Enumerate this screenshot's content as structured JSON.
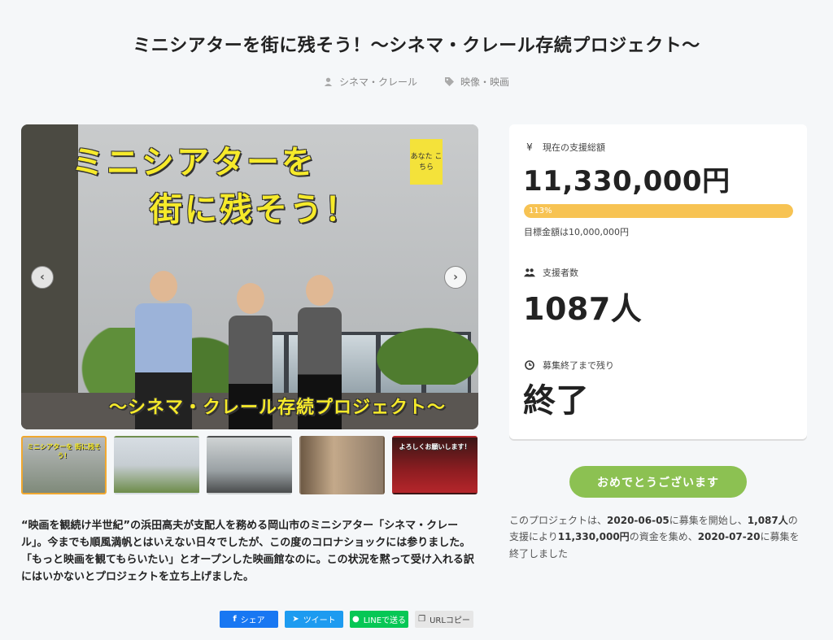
{
  "project": {
    "title": "ミニシアターを街に残そう！〜シネマ・クレール存続プロジェクト〜",
    "author": "シネマ・クレール",
    "category": "映像・映画"
  },
  "hero": {
    "text_line1": "ミニシアターを",
    "text_line2": "街に残そう！",
    "text_line3": "〜シネマ・クレール存続プロジェクト〜",
    "sticker": "あなた こちら"
  },
  "carousel": {
    "prev_icon": "chevron-left-icon",
    "next_icon": "chevron-right-icon",
    "thumbnails": [
      {
        "label": "ミニシアターを 街に残そう！",
        "active": true
      },
      {
        "label": "",
        "active": false
      },
      {
        "label": "",
        "active": false
      },
      {
        "label": "",
        "active": false
      },
      {
        "label": "よろしくお願いします！",
        "active": false
      }
    ]
  },
  "description": "“映画を観続け半世紀”の浜田高夫が支配人を務める岡山市のミニシアター「シネマ・クレール」。今までも順風満帆とはいえない日々でしたが、この度のコロナショックには参りました。「もっと映画を観てもらいたい」とオープンした映画館なのに。この状況を黙って受け入れる訳にはいかないとプロジェクトを立ち上げました。",
  "share": {
    "facebook": "シェア",
    "twitter": "ツイート",
    "line": "LINEで送る",
    "url": "URLコピー"
  },
  "stats": {
    "total_label": "現在の支援総額",
    "total_value": "11,330,000円",
    "progress_percent": 113,
    "progress_label": "113%",
    "goal_text": "目標金額は10,000,000円",
    "supporters_label": "支援者数",
    "supporters_value": "1087人",
    "remaining_label": "募集終了まで残り",
    "remaining_value": "終了"
  },
  "congrats_button": "おめでとうございます",
  "summary": {
    "p1": "このプロジェクトは、",
    "start_date": "2020-06-05",
    "p2": "に募集を開始し、",
    "supporters": "1,087人",
    "p3": "の支援により",
    "amount": "11,330,000円",
    "p4": "の資金を集め、",
    "end_date": "2020-07-20",
    "p5": "に募集を終了しました"
  },
  "colors": {
    "accent_green": "#8cc152",
    "progress_yellow": "#f7c353",
    "facebook": "#1877f2",
    "twitter": "#1d9bf0",
    "line": "#06c755"
  }
}
